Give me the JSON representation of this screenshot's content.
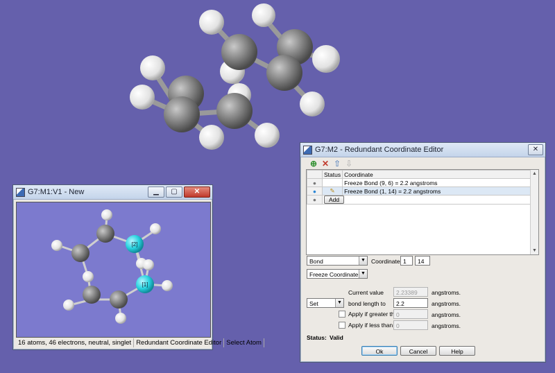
{
  "viewer": {
    "title": "G7:M1:V1 - New",
    "status": {
      "info": "16 atoms, 46 electrons, neutral, singlet",
      "mode": "Redundant Coordinate Editor",
      "action": "Select Atom"
    },
    "atom_labels": [
      "[2]",
      "[1]"
    ],
    "colors": {
      "highlight_atom": "#28d3e0",
      "carbon": "#888888",
      "hydrogen": "#eeeeee"
    }
  },
  "editor": {
    "title": "G7:M2 - Redundant Coordinate Editor",
    "toolbar": {
      "icons": [
        "add-row-icon",
        "delete-icon",
        "move-up-icon",
        "move-down-icon"
      ]
    },
    "table": {
      "headers": [
        "Status",
        "Coordinate"
      ],
      "rows": [
        {
          "status": "",
          "coordinate": "Freeze Bond (9, 6) = 2.2 angstroms"
        },
        {
          "status": "pencil-icon",
          "coordinate": "Freeze Bond (1, 14) = 2.2 angstroms"
        }
      ],
      "add_label": "Add"
    },
    "coordinate_type": "Bond",
    "coordinate_label": "Coordinate:",
    "atom1": "1",
    "atom2": "14",
    "action": "Freeze Coordinate",
    "current_value_label": "Current value",
    "current_value": "2.23389",
    "set_option": "Set",
    "bond_length_label": "bond length to",
    "bond_length_value": "2.2",
    "apply_greater_label": "Apply if greater than",
    "apply_greater_value": "0",
    "apply_less_label": "Apply if less than",
    "apply_less_value": "0",
    "unit": "angstroms.",
    "status_label": "Status:",
    "status_value": "Valid",
    "buttons": {
      "ok": "Ok",
      "cancel": "Cancel",
      "help": "Help"
    }
  },
  "background_color": "#6560ac"
}
